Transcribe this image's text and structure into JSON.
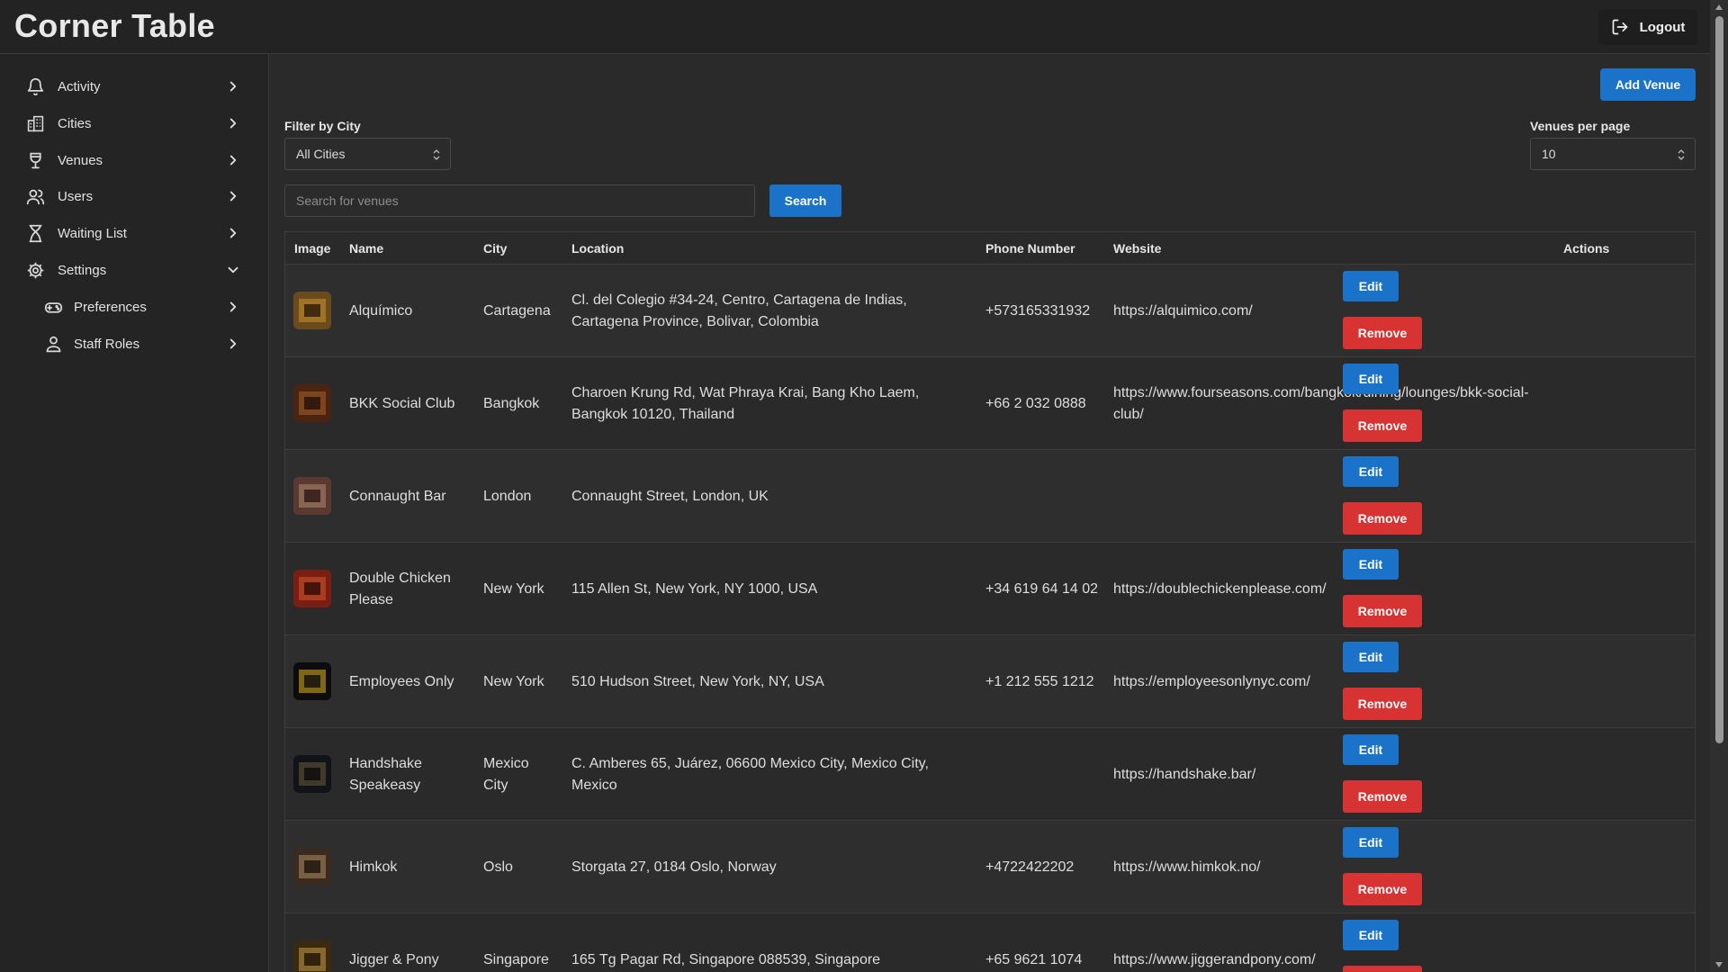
{
  "header": {
    "title": "Corner Table",
    "logout_label": "Logout"
  },
  "sidebar": {
    "items": [
      {
        "label": "Activity",
        "icon": "bell-icon"
      },
      {
        "label": "Cities",
        "icon": "city-icon"
      },
      {
        "label": "Venues",
        "icon": "cocktail-icon"
      },
      {
        "label": "Users",
        "icon": "users-icon"
      },
      {
        "label": "Waiting List",
        "icon": "hourglass-icon"
      },
      {
        "label": "Settings",
        "icon": "gear-icon",
        "expanded": true
      },
      {
        "label": "Preferences",
        "icon": "gamepad-icon",
        "sub": true
      },
      {
        "label": "Staff Roles",
        "icon": "person-icon",
        "sub": true
      }
    ]
  },
  "toolbar": {
    "add_venue_label": "Add Venue",
    "filter_label": "Filter by City",
    "filter_value": "All Cities",
    "per_page_label": "Venues per page",
    "per_page_value": "10",
    "search_placeholder": "Search for venues",
    "search_label": "Search"
  },
  "table": {
    "headers": [
      "Image",
      "Name",
      "City",
      "Location",
      "Phone Number",
      "Website",
      "Actions"
    ],
    "edit_label": "Edit",
    "remove_label": "Remove",
    "rows": [
      {
        "name": "Alquímico",
        "city": "Cartagena",
        "location": "Cl. del Colegio #34-24, Centro, Cartagena de Indias, Cartagena Province, Bolivar, Colombia",
        "phone": "+573165331932",
        "website": "https://alquimico.com/"
      },
      {
        "name": "BKK Social Club",
        "city": "Bangkok",
        "location": "Charoen Krung Rd, Wat Phraya Krai, Bang Kho Laem, Bangkok 10120, Thailand",
        "phone": "+66 2 032 0888",
        "website": "https://www.fourseasons.com/bangkok/dining/lounges/bkk-social-club/"
      },
      {
        "name": "Connaught Bar",
        "city": "London",
        "location": "Connaught Street, London, UK",
        "phone": "",
        "website": ""
      },
      {
        "name": "Double Chicken Please",
        "city": "New York",
        "location": "115 Allen St, New York, NY 1000, USA",
        "phone": "+34 619 64 14 02",
        "website": "https://doublechickenplease.com/"
      },
      {
        "name": "Employees Only",
        "city": "New York",
        "location": "510 Hudson Street, New York, NY, USA",
        "phone": "+1 212 555 1212",
        "website": "https://employeesonlynyc.com/"
      },
      {
        "name": "Handshake Speakeasy",
        "city": "Mexico City",
        "location": "C. Amberes 65, Juárez, 06600 Mexico City, Mexico City, Mexico",
        "phone": "",
        "website": "https://handshake.bar/"
      },
      {
        "name": "Himkok",
        "city": "Oslo",
        "location": "Storgata 27, 0184 Oslo, Norway",
        "phone": "+4722422202",
        "website": "https://www.himkok.no/"
      },
      {
        "name": "Jigger & Pony",
        "city": "Singapore",
        "location": "165 Tg Pagar Rd, Singapore 088539, Singapore",
        "phone": "+65 9621 1074",
        "website": "https://www.jiggerandpony.com/"
      }
    ]
  },
  "colors": {
    "accent": "#1a73c8",
    "danger": "#d83333",
    "background": "#2a2a2a"
  }
}
